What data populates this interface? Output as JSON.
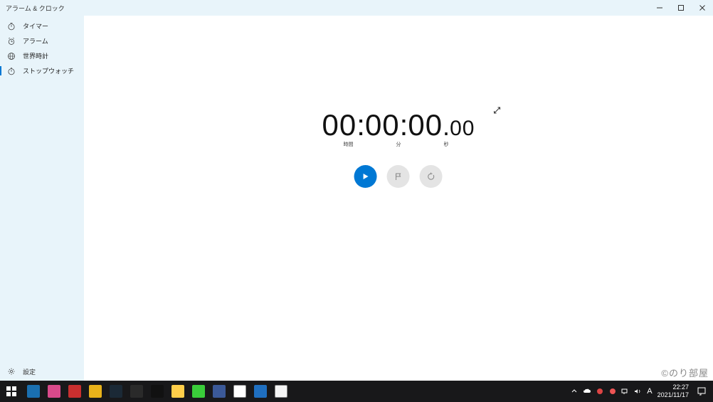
{
  "app": {
    "title": "アラーム & クロック"
  },
  "sidebar": {
    "items": [
      {
        "id": "timer",
        "label": "タイマー",
        "icon": "timer-icon"
      },
      {
        "id": "alarm",
        "label": "アラーム",
        "icon": "alarm-icon"
      },
      {
        "id": "worldclock",
        "label": "世界時計",
        "icon": "worldclock-icon"
      },
      {
        "id": "stopwatch",
        "label": "ストップウォッチ",
        "icon": "stopwatch-icon",
        "selected": true
      }
    ],
    "settings_label": "設定"
  },
  "stopwatch": {
    "hours": "00",
    "minutes": "00",
    "seconds": "00",
    "centiseconds": "00",
    "label_hours": "時間",
    "label_minutes": "分",
    "label_seconds": "秒"
  },
  "controls": {
    "start": "start",
    "lap": "lap",
    "reset": "reset"
  },
  "watermark": "©のり部屋",
  "taskbar": {
    "icons": [
      {
        "id": "explorer",
        "color": "#1a6fb0"
      },
      {
        "id": "app1",
        "color": "#d94a8b"
      },
      {
        "id": "app2",
        "color": "#c92f2f"
      },
      {
        "id": "app3",
        "color": "#e8b21a"
      },
      {
        "id": "app4",
        "color": "#1b2936"
      },
      {
        "id": "app5",
        "color": "#2a2a2a"
      },
      {
        "id": "steam",
        "color": "#111"
      },
      {
        "id": "folder",
        "color": "#ffcf4a"
      },
      {
        "id": "line",
        "color": "#3acd3a"
      },
      {
        "id": "app6",
        "color": "#3b5998"
      },
      {
        "id": "chrome",
        "color": "#ffffff"
      },
      {
        "id": "edge",
        "color": "#1f6fc0"
      },
      {
        "id": "clock-app",
        "color": "#f5f5f5"
      }
    ],
    "ime": "A",
    "time": "22:27",
    "date": "2021/11/17"
  }
}
